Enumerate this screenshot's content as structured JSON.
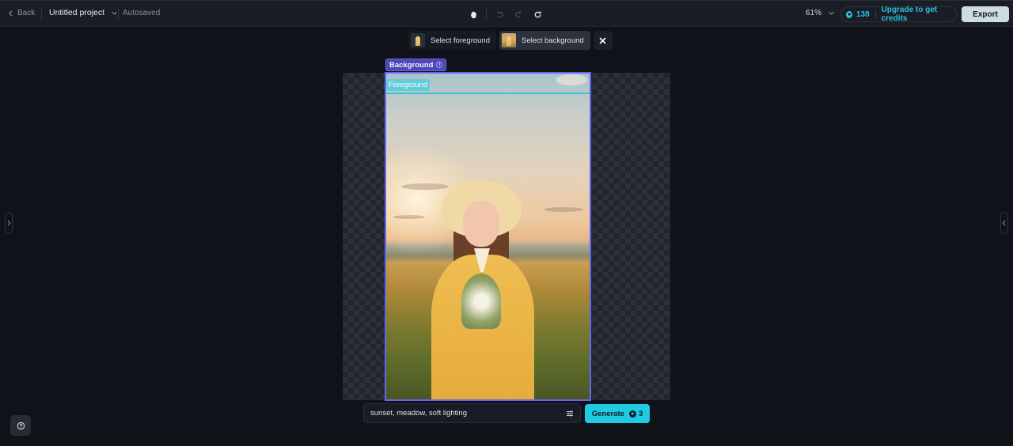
{
  "topbar": {
    "back_label": "Back",
    "project_name": "Untitled project",
    "save_status": "Autosaved",
    "zoom_level": "61%",
    "credits_count": "138",
    "upgrade_label": "Upgrade to get credits",
    "export_label": "Export",
    "tools": [
      {
        "icon": "hand-icon",
        "label": "Pan"
      },
      {
        "icon": "undo-icon",
        "label": "Undo",
        "enabled": false
      },
      {
        "icon": "redo-icon",
        "label": "Redo",
        "enabled": false
      },
      {
        "icon": "refresh-icon",
        "label": "Reset"
      }
    ]
  },
  "selection_toolbar": {
    "items": [
      {
        "label": "Select foreground",
        "active": false
      },
      {
        "label": "Select background",
        "active": true
      }
    ],
    "close_icon": "close-icon"
  },
  "canvas": {
    "layers": {
      "background_label": "Background",
      "foreground_label": "Foreground"
    },
    "image_description": "Woman in straw hat and yellow dress holding wildflowers in a meadow at sunset"
  },
  "prompt": {
    "value": "sunset, meadow, soft lighting",
    "settings_icon": "sliders-icon"
  },
  "generate": {
    "label": "Generate",
    "cost": "3"
  },
  "colors": {
    "accent_cyan": "#1fcbe0",
    "selection_purple": "#6366f1",
    "foreground_cyan": "#35c7d8",
    "background": "#0f1218"
  }
}
